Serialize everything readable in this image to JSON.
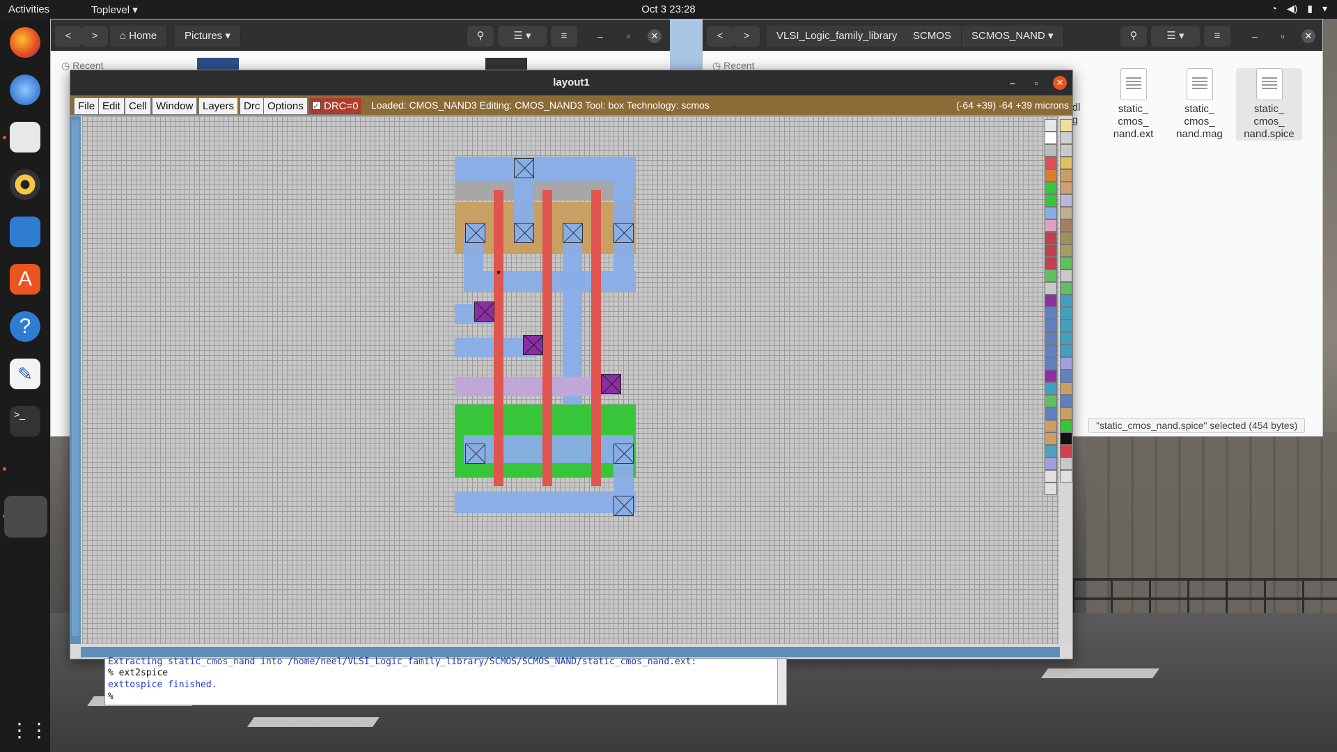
{
  "topbar": {
    "activities": "Activities",
    "app_menu": "Toplevel",
    "clock": "Oct 3  23:28"
  },
  "file_manager_left": {
    "back": "<",
    "forward": ">",
    "crumbs": [
      "Home",
      "Pictures"
    ],
    "sidebar_recent": "Recent"
  },
  "file_manager_right": {
    "crumbs": [
      "VLSI_Logic_family_library",
      "SCMOS",
      "SCMOS_NAND"
    ],
    "sidebar_recent": "Recent",
    "partial_file_line1": "andl",
    "partial_file_line2": "png",
    "files": [
      {
        "line1": "static_",
        "line2": "cmos_",
        "line3": "nand.ext"
      },
      {
        "line1": "static_",
        "line2": "cmos_",
        "line3": "nand.mag"
      },
      {
        "line1": "static_",
        "line2": "cmos_",
        "line3": "nand.spice"
      }
    ],
    "selection_status": "\"static_cmos_nand.spice\" selected (454 bytes)"
  },
  "magic": {
    "title": "layout1",
    "menus": [
      "File",
      "Edit",
      "Cell",
      "Window",
      "Layers",
      "Drc",
      "Options"
    ],
    "drc": "DRC=0",
    "status": "Loaded: CMOS_NAND3 Editing: CMOS_NAND3 Tool: box  Technology: scmos",
    "coords": "(-64 +39) -64 +39 microns"
  },
  "console": {
    "line1": "Extracting static_cmos_nand into /home/neel/VLSI_Logic_family_library/SCMOS/SCMOS_NAND/static_cmos_nand.ext:",
    "line2": "% ext2spice",
    "line3": "exttospice finished.",
    "line4": "%"
  },
  "colors": {
    "menu_bar": "#8b6b36",
    "drc_button": "#b03b2b",
    "metal1": "#88aee8",
    "poly": "#e0564f",
    "pdiffusion": "#37c63a",
    "ndiffusion": "#c8a064",
    "via": "#8b2ea3",
    "metal2": "#bfa7d8"
  }
}
